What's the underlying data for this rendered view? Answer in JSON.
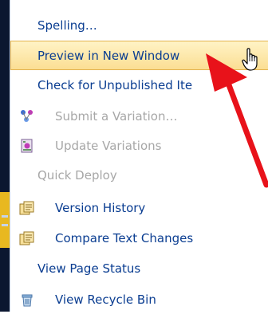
{
  "menu": {
    "items": [
      {
        "label": "Spelling…",
        "enabled": true,
        "icon": null
      },
      {
        "label": "Preview in New Window",
        "enabled": true,
        "icon": null,
        "highlighted": true
      },
      {
        "label": "Check for Unpublished Ite",
        "enabled": true,
        "icon": null
      },
      {
        "label": "Submit a Variation…",
        "enabled": false,
        "icon": "variation-icon"
      },
      {
        "label": "Update Variations",
        "enabled": false,
        "icon": "update-variations-icon"
      },
      {
        "label": "Quick Deploy",
        "enabled": false,
        "icon": null
      },
      {
        "label": "Version History",
        "enabled": true,
        "icon": "version-history-icon"
      },
      {
        "label": "Compare Text Changes",
        "enabled": true,
        "icon": "compare-icon"
      },
      {
        "label": "View Page Status",
        "enabled": true,
        "icon": null
      },
      {
        "label": "View Recycle Bin",
        "enabled": true,
        "icon": "recycle-bin-icon"
      }
    ]
  },
  "colors": {
    "link": "#0a3d91",
    "disabled": "#a7a7a7",
    "highlight": "#fbde93",
    "annotation_arrow": "#e8121a"
  },
  "annotation": {
    "type": "arrow",
    "points_to": "Preview in New Window"
  },
  "cursor": {
    "type": "hand-pointer"
  }
}
